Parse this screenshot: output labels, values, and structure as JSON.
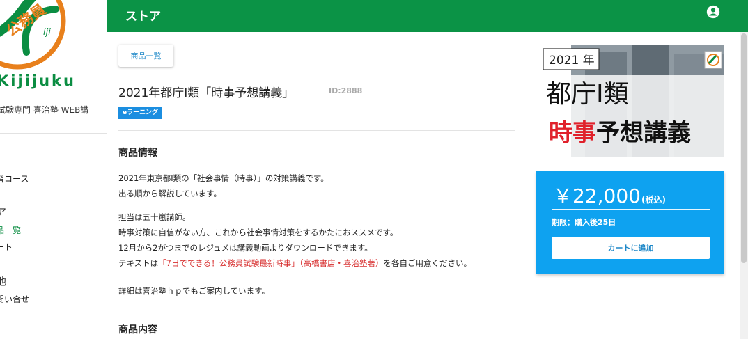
{
  "sidebar": {
    "logo_text": "Kijijuku",
    "logo_badge_text": "公務員",
    "site_name": "試験専門 喜治塾 WEB講",
    "items": [
      {
        "label": "習コース"
      },
      {
        "label": "ア"
      },
      {
        "label": "品一覧"
      },
      {
        "label": "ート"
      },
      {
        "label": "他"
      },
      {
        "label": "問い合せ"
      }
    ]
  },
  "header": {
    "title": "ストア"
  },
  "main": {
    "list_button_label": "商品一覧",
    "product_title": "2021年都庁Ⅰ類「時事予想講義」",
    "product_id": "ID:2888",
    "badge": "eラーニング",
    "section_info_title": "商品情報",
    "description": {
      "line1": "2021年東京都Ⅰ類の「社会事情（時事）」の対策講義です。",
      "line2": "出る順から解説しています。",
      "line3": "担当は五十嵐講師。",
      "line4": "時事対策に自信がない方、これから社会事情対策をするかたにおススメです。",
      "line5": "12月から2がつまでのレジュメは講義動画よりダウンロードできます。",
      "line6_pre": "テキストは",
      "line6_red": "「7日でできる！公務員試験最新時事」（高橋書店・喜治塾著）",
      "line6_post": "を各自ご用意ください。",
      "line7": "詳細は喜治塾ｈｐでもご案内しています。"
    },
    "section_content_title": "商品内容"
  },
  "banner": {
    "year": "2021 年",
    "line1": "都庁Ⅰ類",
    "line2_red": "時事",
    "line2_black": "予想講義"
  },
  "price_card": {
    "price": "￥22,000",
    "tax": "(税込)",
    "period": "期限：購入後25日",
    "cart_button": "カートに追加"
  },
  "colors": {
    "header_green": "#0b9346",
    "price_blue": "#0ea2f0",
    "link_blue": "#1e88c8",
    "badge_blue": "#1b8ee0",
    "note_red": "#d72d2d",
    "logo_orange": "#e8801c"
  }
}
